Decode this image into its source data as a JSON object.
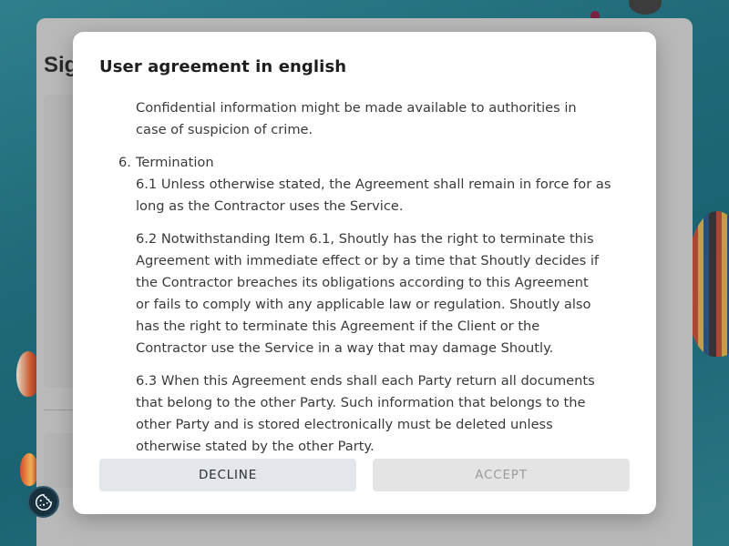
{
  "page": {
    "title": "Sig"
  },
  "modal": {
    "title": "User agreement in english",
    "paragraphs": {
      "p0": "Confidential information might be made available to authorities in",
      "p0b": "case of suspicion of crime.",
      "section_number": "6.",
      "section_title": "Termination",
      "p61a": "6.1 Unless otherwise stated, the Agreement shall remain in force for as",
      "p61b": "long as the Contractor uses the Service.",
      "p62a": "6.2 Notwithstanding Item 6.1, Shoutly has the right to terminate this",
      "p62b": "Agreement with immediate effect or by a time that Shoutly decides if",
      "p62c": "the Contractor breaches its obligations according to this Agreement",
      "p62d": "or fails to comply with any applicable law or regulation. Shoutly also",
      "p62e": "has the right to terminate this Agreement if the Client or the",
      "p62f": "Contractor use the Service in a way that may damage Shoutly.",
      "p63a": "6.3 When this Agreement ends shall each Party return all documents",
      "p63b": "that belong to the other Party. Such information that belongs to the",
      "p63c": "other Party and is stored electronically must be deleted unless",
      "p63d": "otherwise stated by the other Party."
    },
    "decline_label": "DECLINE",
    "accept_label": "ACCEPT"
  },
  "colors": {
    "decline_bg": "#e3e6ea",
    "accept_bg": "#e4e4e4",
    "accept_text_disabled": "#9b9b9b"
  },
  "icons": {
    "cookie_fab": "cookie-icon"
  }
}
